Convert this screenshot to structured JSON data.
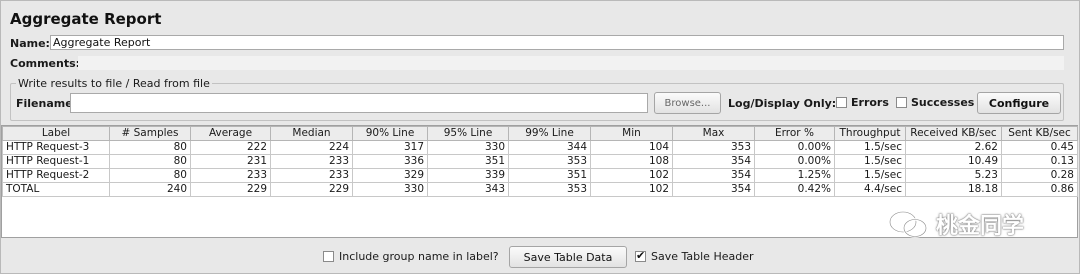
{
  "title": "Aggregate Report",
  "name_label": "Name:",
  "name_value": "Aggregate Report",
  "comments_label": "Comments:",
  "file_section": {
    "legend": "Write results to file / Read from file",
    "filename_label": "Filename",
    "browse_label": "Browse...",
    "log_display_label": "Log/Display Only:",
    "errors_label": "Errors",
    "successes_label": "Successes",
    "configure_label": "Configure"
  },
  "table": {
    "columns": [
      "Label",
      "# Samples",
      "Average",
      "Median",
      "90% Line",
      "95% Line",
      "99% Line",
      "Min",
      "Max",
      "Error %",
      "Throughput",
      "Received KB/sec",
      "Sent KB/sec"
    ],
    "rows": [
      [
        "HTTP Request-3",
        "80",
        "222",
        "224",
        "317",
        "330",
        "344",
        "104",
        "353",
        "0.00%",
        "1.5/sec",
        "2.62",
        "0.45"
      ],
      [
        "HTTP Request-1",
        "80",
        "231",
        "233",
        "336",
        "351",
        "353",
        "108",
        "354",
        "0.00%",
        "1.5/sec",
        "10.49",
        "0.13"
      ],
      [
        "HTTP Request-2",
        "80",
        "233",
        "233",
        "329",
        "339",
        "351",
        "102",
        "354",
        "1.25%",
        "1.5/sec",
        "5.23",
        "0.28"
      ],
      [
        "TOTAL",
        "240",
        "229",
        "229",
        "330",
        "343",
        "353",
        "102",
        "354",
        "0.42%",
        "4.4/sec",
        "18.18",
        "0.86"
      ]
    ]
  },
  "bottom": {
    "include_group_label": "Include group name in label?",
    "include_group_checked": false,
    "save_table_data_label": "Save Table Data",
    "save_table_header_label": "Save Table Header",
    "save_table_header_checked": true
  },
  "watermark": {
    "text": "桃金同学",
    "icon": "wechat-icon"
  }
}
